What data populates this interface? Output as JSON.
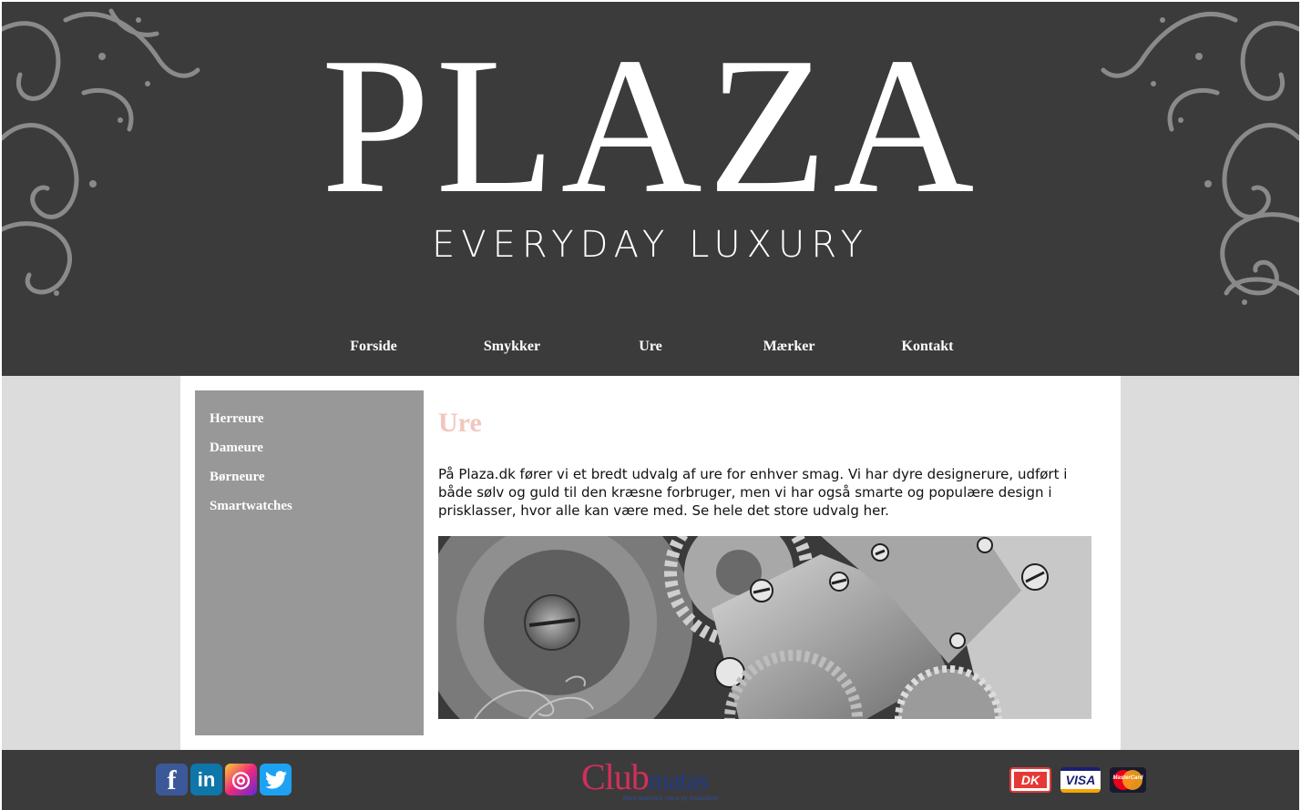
{
  "header": {
    "logo_title": "PLAZA",
    "logo_subtitle": "EVERYDAY LUXURY"
  },
  "nav": {
    "items": [
      {
        "label": "Forside"
      },
      {
        "label": "Smykker"
      },
      {
        "label": "Ure"
      },
      {
        "label": "Mærker"
      },
      {
        "label": "Kontakt"
      }
    ]
  },
  "sidebar": {
    "items": [
      {
        "label": "Herreure"
      },
      {
        "label": "Dameure"
      },
      {
        "label": "Børneure"
      },
      {
        "label": "Smartwatches"
      }
    ]
  },
  "main": {
    "title": "Ure",
    "intro": "På Plaza.dk fører vi et bredt udvalg af ure for enhver smag. Vi har dyre designerure, udført i både sølv og guld til den kræsne forbruger, men vi har også smarte og populære design i prisklasser, hvor alle kan være med. Se hele det store udvalg her."
  },
  "footer": {
    "social": [
      {
        "icon": "facebook-icon",
        "glyph": "f",
        "color": "#3b5998"
      },
      {
        "icon": "linkedin-icon",
        "glyph": "in",
        "color": "#0e76a8"
      },
      {
        "icon": "instagram-icon",
        "glyph": "◎",
        "color": "#c13584"
      },
      {
        "icon": "twitter-icon",
        "glyph": "🐦",
        "color": "#1da1f2"
      }
    ],
    "club_logo": {
      "part1": "Club",
      "part2": "matas",
      "tagline": "Mere skønhed, mere ny inspiration"
    },
    "payments": [
      {
        "icon": "dankort-icon",
        "label": "DK"
      },
      {
        "icon": "visa-icon",
        "label": "VISA"
      },
      {
        "icon": "mastercard-icon",
        "label": "MasterCard"
      }
    ]
  },
  "colors": {
    "header_bg": "#3c3b3c",
    "page_bg": "#dcdcdc",
    "sidebar_bg": "#989898",
    "title_accent": "#f2c6bd"
  }
}
